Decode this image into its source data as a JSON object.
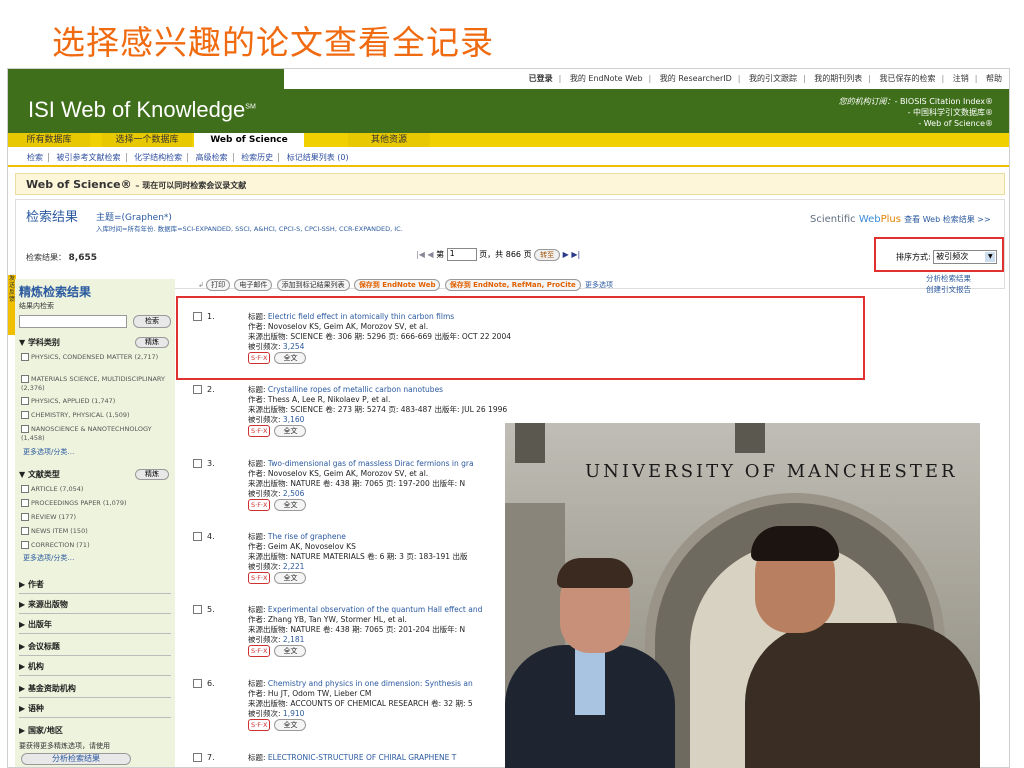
{
  "slide_title": "选择感兴趣的论文查看全记录",
  "top_links": [
    "已登录",
    "我的 EndNote Web",
    "我的 ResearcherID",
    "我的引文跟踪",
    "我的期刊列表",
    "我已保存的检索",
    "注销",
    "帮助"
  ],
  "logo": {
    "text": "ISI Web of Knowledge",
    "mark": "SM"
  },
  "subscription": {
    "label": "您的机构订阅：",
    "lines": [
      "- BIOSIS Citation Index®",
      "- 中国科学引文数据库®",
      "- Web of Science®"
    ]
  },
  "tabs": [
    "所有数据库",
    "选择一个数据库",
    "Web of Science",
    "其他资源"
  ],
  "subnav": [
    "检索",
    "被引参考文献检索",
    "化学结构检索",
    "高级检索",
    "检索历史",
    "标记结果列表 (0)"
  ],
  "wos_bar": {
    "title": "Web of Science®",
    "sub": "– 现在可以同时检索会议录文献"
  },
  "results": {
    "title": "检索结果",
    "topic": "主题=(Graphen*)",
    "meta": "入库时间=所有年份. 数据库=SCI-EXPANDED, SSCI, A&HCI, CPCI-S, CPCI-SSH, CCR-EXPANDED, IC.",
    "count_label": "检索结果：",
    "count": "8,655",
    "page_label": "第",
    "page": "1",
    "of_label": "页，共",
    "total_pages": "866",
    "pages_suffix": "页",
    "go": "转至",
    "sort_label": "排序方式:",
    "sort_value": "被引频次"
  },
  "webplus": {
    "prefix": "Scientific",
    "brand": "Web",
    "plus": "Plus",
    "link": "查看 Web 检索结果 >>"
  },
  "sidebar": {
    "title": "精炼检索结果",
    "within": "结果内检索",
    "search_btn": "检索",
    "subject_head": "学科类别",
    "refine": "精炼",
    "subjects": [
      "PHYSICS, CONDENSED MATTER (2,717)",
      "MATERIALS SCIENCE, MULTIDISCIPLINARY (2,376)",
      "PHYSICS, APPLIED (1,747)",
      "CHEMISTRY, PHYSICAL (1,509)",
      "NANOSCIENCE & NANOTECHNOLOGY (1,458)"
    ],
    "more1": "更多选项/分类…",
    "doctype_head": "文献类型",
    "doctypes": [
      "ARTICLE (7,054)",
      "PROCEEDINGS PAPER (1,079)",
      "REVIEW (177)",
      "NEWS ITEM (150)",
      "CORRECTION (71)"
    ],
    "more2": "更多选项/分类…",
    "sections": [
      "作者",
      "来源出版物",
      "出版年",
      "会议标题",
      "机构",
      "基金资助机构",
      "语种",
      "国家/地区"
    ],
    "foot": "要获得更多精炼选项，请使用",
    "analyze": "分析检索结果"
  },
  "side_tab": "发送反馈",
  "toolbar": {
    "print": "打印",
    "email": "电子邮件",
    "add": "添加到标记结果列表",
    "save_web": "保存到 EndNote Web",
    "save_ref": "保存到 EndNote, RefMan, ProCite",
    "more": "更多选项"
  },
  "analyze_links": [
    "分析检索结果",
    "创建引文报告"
  ],
  "records": [
    {
      "n": "1.",
      "title": "Electric field effect in atomically thin carbon films",
      "authors": "作者: Novoselov KS, Geim AK, Morozov SV, et al.",
      "source": "来源出版物: SCIENCE  卷: 306  期: 5296  页: 666-669  出版年: OCT 22 2004",
      "cites": "3,254"
    },
    {
      "n": "2.",
      "title": "Crystalline ropes of metallic carbon nanotubes",
      "authors": "作者: Thess A, Lee R, Nikolaev P, et al.",
      "source": "来源出版物: SCIENCE  卷: 273  期: 5274  页: 483-487  出版年: JUL 26 1996",
      "cites": "3,160"
    },
    {
      "n": "3.",
      "title": "Two-dimensional gas of massless Dirac fermions in gra",
      "authors": "作者: Novoselov KS, Geim AK, Morozov SV, et al.",
      "source": "来源出版物: NATURE  卷: 438  期: 7065  页: 197-200  出版年: N",
      "cites": "2,506"
    },
    {
      "n": "4.",
      "title": "The rise of graphene",
      "authors": "作者: Geim AK, Novoselov KS",
      "source": "来源出版物: NATURE MATERIALS  卷: 6  期: 3  页: 183-191  出版",
      "cites": "2,221"
    },
    {
      "n": "5.",
      "title": "Experimental observation of the quantum Hall effect and",
      "authors": "作者: Zhang YB, Tan YW, Stormer HL, et al.",
      "source": "来源出版物: NATURE  卷: 438  期: 7065  页: 201-204  出版年: N",
      "cites": "2,181"
    },
    {
      "n": "6.",
      "title": "Chemistry and physics in one dimension: Synthesis an",
      "authors": "作者: Hu JT, Odom TW, Lieber CM",
      "source": "来源出版物: ACCOUNTS OF CHEMICAL RESEARCH  卷: 32  期: 5",
      "cites": "1,910"
    },
    {
      "n": "7.",
      "title": "ELECTRONIC-STRUCTURE OF CHIRAL GRAPHENE T",
      "authors": "",
      "source": "",
      "cites": ""
    }
  ],
  "labels": {
    "title_prefix": "标题: ",
    "cites_prefix": "被引频次: ",
    "sfx": "S·F·X",
    "fulltext": "全文"
  },
  "photo_sign": "UNIVERSITY OF MANCHESTER"
}
